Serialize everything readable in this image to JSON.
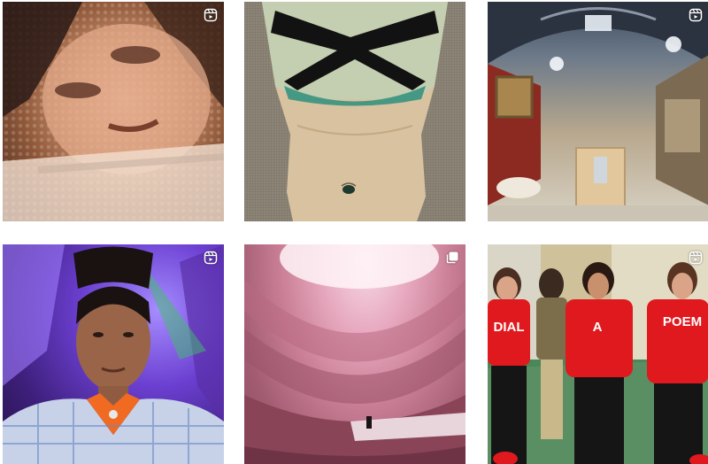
{
  "grid": {
    "posts": [
      {
        "id": "post-1",
        "media": "reel",
        "badge_icon": "reel-icon"
      },
      {
        "id": "post-2",
        "media": "image",
        "badge_icon": ""
      },
      {
        "id": "post-3",
        "media": "reel",
        "badge_icon": "reel-icon"
      },
      {
        "id": "post-4",
        "media": "reel",
        "badge_icon": "reel-icon"
      },
      {
        "id": "post-5",
        "media": "carousel",
        "badge_icon": "carousel-icon"
      },
      {
        "id": "post-6",
        "media": "reel",
        "badge_icon": "reel-icon"
      }
    ]
  },
  "post6": {
    "shirt_words": [
      "DIAL",
      "A",
      "POEM"
    ]
  },
  "colors": {
    "shirt_red": "#e0191f",
    "badge_white": "#ffffff"
  }
}
